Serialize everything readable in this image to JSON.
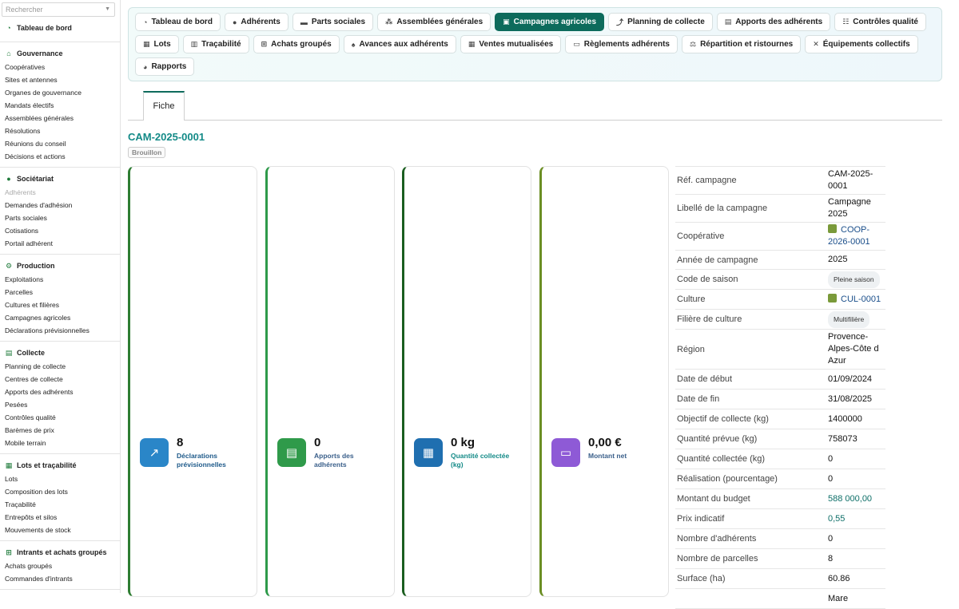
{
  "search": {
    "placeholder": "Rechercher"
  },
  "sidebar": {
    "groups": [
      {
        "title": "Tableau de bord",
        "icon": "dashboard-icon",
        "items": []
      },
      {
        "title": "Gouvernance",
        "icon": "bank-icon",
        "items": [
          "Coopératives",
          "Sites et antennes",
          "Organes de gouvernance",
          "Mandats électifs",
          "Assemblées générales",
          "Résolutions",
          "Réunions du conseil",
          "Décisions et actions"
        ]
      },
      {
        "title": "Sociétariat",
        "icon": "user-icon",
        "items": [
          "Adhérents",
          "Demandes d'adhésion",
          "Parts sociales",
          "Cotisations",
          "Portail adhérent"
        ]
      },
      {
        "title": "Production",
        "icon": "tractor-icon",
        "items": [
          "Exploitations",
          "Parcelles",
          "Cultures et filières",
          "Campagnes agricoles",
          "Déclarations prévisionnelles"
        ]
      },
      {
        "title": "Collecte",
        "icon": "truck-icon",
        "items": [
          "Planning de collecte",
          "Centres de collecte",
          "Apports des adhérents",
          "Pesées",
          "Contrôles qualité",
          "Barèmes de prix",
          "Mobile terrain"
        ]
      },
      {
        "title": "Lots et traçabilité",
        "icon": "boxes-icon",
        "items": [
          "Lots",
          "Composition des lots",
          "Traçabilité",
          "Entrepôts et silos",
          "Mouvements de stock"
        ]
      },
      {
        "title": "Intrants et achats groupés",
        "icon": "cart-icon",
        "items": [
          "Achats groupés",
          "Commandes d'intrants"
        ]
      }
    ]
  },
  "tabs": {
    "row1": [
      "Tableau de bord",
      "Adhérents",
      "Parts sociales",
      "Assemblées générales",
      "Campagnes agricoles",
      "Planning de collecte",
      "Apports des adhérents",
      "Contrôles qualité"
    ],
    "row2": [
      "Lots",
      "Traçabilité",
      "Achats groupés",
      "Avances aux adhérents",
      "Ventes mutualisées",
      "Règlements adhérents",
      "Répartition et ristournes",
      "Équipements collectifs"
    ],
    "row3": [
      "Rapports"
    ],
    "active": "Campagnes agricoles"
  },
  "subtab": {
    "label": "Fiche"
  },
  "record": {
    "title": "CAM-2025-0001",
    "status": "Brouillon"
  },
  "kpis": [
    {
      "value": "8",
      "label": "Déclarations prévisionnelles",
      "color": "#2a86c8",
      "icon": "chart-icon",
      "label_color": "#1e5a8a"
    },
    {
      "value": "0",
      "label": "Apports des adhérents",
      "color": "#2f9a4a",
      "icon": "truck-icon",
      "label_color": "#3a5f8a"
    },
    {
      "value": "0 kg",
      "label": "Quantité collectée (kg)",
      "color": "#1f6fb0",
      "icon": "boxes-icon",
      "label_color": "#138a87"
    },
    {
      "value": "0,00 €",
      "label": "Montant net",
      "color": "#8e5ad6",
      "icon": "money-icon",
      "label_color": "#3a5f8a"
    }
  ],
  "details": [
    {
      "label": "Réf. campagne",
      "value": "CAM-2025-0001"
    },
    {
      "label": "Libellé de la campagne",
      "value": "Campagne 2025"
    },
    {
      "label": "Coopérative",
      "value": "COOP-2026-0001",
      "kind": "link"
    },
    {
      "label": "Année de campagne",
      "value": "2025"
    },
    {
      "label": "Code de saison",
      "value": "Pleine saison",
      "kind": "pill"
    },
    {
      "label": "Culture",
      "value": "CUL-0001",
      "kind": "link"
    },
    {
      "label": "Filière de culture",
      "value": "Multifilière",
      "kind": "pill"
    },
    {
      "label": "Région",
      "value": "Provence-Alpes-Côte d Azur"
    },
    {
      "label": "Date de début",
      "value": "01/09/2024"
    },
    {
      "label": "Date de fin",
      "value": "31/08/2025"
    },
    {
      "label": "Objectif de collecte (kg)",
      "value": "1400000"
    },
    {
      "label": "Quantité prévue (kg)",
      "value": "758073"
    },
    {
      "label": "Quantité collectée (kg)",
      "value": "0"
    },
    {
      "label": "Réalisation (pourcentage)",
      "value": "0"
    },
    {
      "label": "Montant du budget",
      "value": "588 000,00",
      "kind": "money"
    },
    {
      "label": "Prix indicatif",
      "value": "0,55",
      "kind": "money"
    },
    {
      "label": "Nombre d'adhérents",
      "value": "0"
    },
    {
      "label": "Nombre de parcelles",
      "value": "8"
    },
    {
      "label": "Surface (ha)",
      "value": "60.86"
    },
    {
      "label": "",
      "value": "Mare"
    }
  ]
}
